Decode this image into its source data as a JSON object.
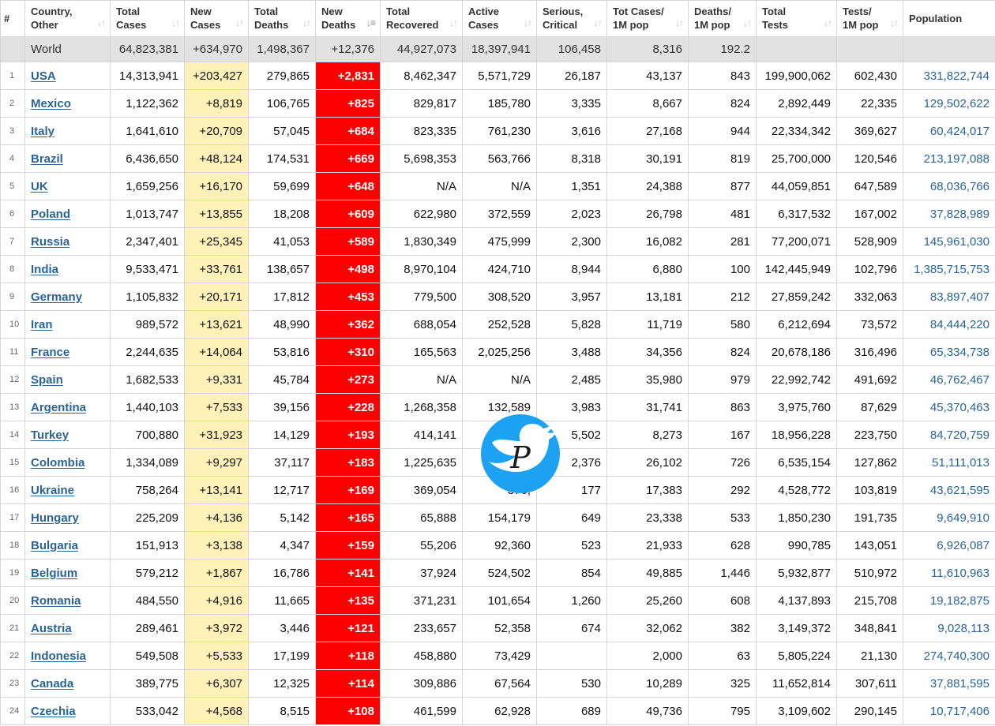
{
  "columns": [
    {
      "key": "num",
      "label": "#"
    },
    {
      "key": "country",
      "label_1": "Country,",
      "label_2": "Other"
    },
    {
      "key": "total_cases",
      "label_1": "Total",
      "label_2": "Cases"
    },
    {
      "key": "new_cases",
      "label_1": "New",
      "label_2": "Cases"
    },
    {
      "key": "total_deaths",
      "label_1": "Total",
      "label_2": "Deaths"
    },
    {
      "key": "new_deaths",
      "label_1": "New",
      "label_2": "Deaths"
    },
    {
      "key": "total_recovered",
      "label_1": "Total",
      "label_2": "Recovered"
    },
    {
      "key": "active_cases",
      "label_1": "Active",
      "label_2": "Cases"
    },
    {
      "key": "serious",
      "label_1": "Serious,",
      "label_2": "Critical"
    },
    {
      "key": "cases_per_1m",
      "label_1": "Tot Cases/",
      "label_2": "1M pop"
    },
    {
      "key": "deaths_per_1m",
      "label_1": "Deaths/",
      "label_2": "1M pop"
    },
    {
      "key": "total_tests",
      "label_1": "Total",
      "label_2": "Tests"
    },
    {
      "key": "tests_per_1m",
      "label_1": "Tests/",
      "label_2": "1M pop"
    },
    {
      "key": "population",
      "label_1": "Population",
      "label_2": ""
    }
  ],
  "sort": {
    "column": "new_deaths",
    "direction": "desc"
  },
  "world": [
    "",
    "World",
    "64,823,381",
    "+634,970",
    "1,498,367",
    "+12,376",
    "44,927,073",
    "18,397,941",
    "106,458",
    "8,316",
    "192.2",
    "",
    "",
    ""
  ],
  "rows": [
    [
      "1",
      "USA",
      "14,313,941",
      "+203,427",
      "279,865",
      "+2,831",
      "8,462,347",
      "5,571,729",
      "26,187",
      "43,137",
      "843",
      "199,900,062",
      "602,430",
      "331,822,744"
    ],
    [
      "2",
      "Mexico",
      "1,122,362",
      "+8,819",
      "106,765",
      "+825",
      "829,817",
      "185,780",
      "3,335",
      "8,667",
      "824",
      "2,892,449",
      "22,335",
      "129,502,622"
    ],
    [
      "3",
      "Italy",
      "1,641,610",
      "+20,709",
      "57,045",
      "+684",
      "823,335",
      "761,230",
      "3,616",
      "27,168",
      "944",
      "22,334,342",
      "369,627",
      "60,424,017"
    ],
    [
      "4",
      "Brazil",
      "6,436,650",
      "+48,124",
      "174,531",
      "+669",
      "5,698,353",
      "563,766",
      "8,318",
      "30,191",
      "819",
      "25,700,000",
      "120,546",
      "213,197,088"
    ],
    [
      "5",
      "UK",
      "1,659,256",
      "+16,170",
      "59,699",
      "+648",
      "N/A",
      "N/A",
      "1,351",
      "24,388",
      "877",
      "44,059,851",
      "647,589",
      "68,036,766"
    ],
    [
      "6",
      "Poland",
      "1,013,747",
      "+13,855",
      "18,208",
      "+609",
      "622,980",
      "372,559",
      "2,023",
      "26,798",
      "481",
      "6,317,532",
      "167,002",
      "37,828,989"
    ],
    [
      "7",
      "Russia",
      "2,347,401",
      "+25,345",
      "41,053",
      "+589",
      "1,830,349",
      "475,999",
      "2,300",
      "16,082",
      "281",
      "77,200,071",
      "528,909",
      "145,961,030"
    ],
    [
      "8",
      "India",
      "9,533,471",
      "+33,761",
      "138,657",
      "+498",
      "8,970,104",
      "424,710",
      "8,944",
      "6,880",
      "100",
      "142,445,949",
      "102,796",
      "1,385,715,753"
    ],
    [
      "9",
      "Germany",
      "1,105,832",
      "+20,171",
      "17,812",
      "+453",
      "779,500",
      "308,520",
      "3,957",
      "13,181",
      "212",
      "27,859,242",
      "332,063",
      "83,897,407"
    ],
    [
      "10",
      "Iran",
      "989,572",
      "+13,621",
      "48,990",
      "+362",
      "688,054",
      "252,528",
      "5,828",
      "11,719",
      "580",
      "6,212,694",
      "73,572",
      "84,444,220"
    ],
    [
      "11",
      "France",
      "2,244,635",
      "+14,064",
      "53,816",
      "+310",
      "165,563",
      "2,025,256",
      "3,488",
      "34,356",
      "824",
      "20,678,186",
      "316,496",
      "65,334,738"
    ],
    [
      "12",
      "Spain",
      "1,682,533",
      "+9,331",
      "45,784",
      "+273",
      "N/A",
      "N/A",
      "2,485",
      "35,980",
      "979",
      "22,992,742",
      "491,692",
      "46,762,467"
    ],
    [
      "13",
      "Argentina",
      "1,440,103",
      "+7,533",
      "39,156",
      "+228",
      "1,268,358",
      "132,589",
      "3,983",
      "31,741",
      "863",
      "3,975,760",
      "87,629",
      "45,370,463"
    ],
    [
      "14",
      "Turkey",
      "700,880",
      "+31,923",
      "14,129",
      "+193",
      "414,141",
      "",
      "5,502",
      "8,273",
      "167",
      "18,956,228",
      "223,750",
      "84,720,759"
    ],
    [
      "15",
      "Colombia",
      "1,334,089",
      "+9,297",
      "37,117",
      "+183",
      "1,225,635",
      "",
      "2,376",
      "26,102",
      "726",
      "6,535,154",
      "127,862",
      "51,111,013"
    ],
    [
      "16",
      "Ukraine",
      "758,264",
      "+13,141",
      "12,717",
      "+169",
      "369,054",
      "376,",
      "177",
      "17,383",
      "292",
      "4,528,772",
      "103,819",
      "43,621,595"
    ],
    [
      "17",
      "Hungary",
      "225,209",
      "+4,136",
      "5,142",
      "+165",
      "65,888",
      "154,179",
      "649",
      "23,338",
      "533",
      "1,850,230",
      "191,735",
      "9,649,910"
    ],
    [
      "18",
      "Bulgaria",
      "151,913",
      "+3,138",
      "4,347",
      "+159",
      "55,206",
      "92,360",
      "523",
      "21,933",
      "628",
      "990,785",
      "143,051",
      "6,926,087"
    ],
    [
      "19",
      "Belgium",
      "579,212",
      "+1,867",
      "16,786",
      "+141",
      "37,924",
      "524,502",
      "854",
      "49,885",
      "1,446",
      "5,932,877",
      "510,972",
      "11,610,963"
    ],
    [
      "20",
      "Romania",
      "484,550",
      "+4,916",
      "11,665",
      "+135",
      "371,231",
      "101,654",
      "1,260",
      "25,260",
      "608",
      "4,137,893",
      "215,708",
      "19,182,875"
    ],
    [
      "21",
      "Austria",
      "289,461",
      "+3,972",
      "3,446",
      "+121",
      "233,657",
      "52,358",
      "674",
      "32,062",
      "382",
      "3,149,372",
      "348,841",
      "9,028,113"
    ],
    [
      "22",
      "Indonesia",
      "549,508",
      "+5,533",
      "17,199",
      "+118",
      "458,880",
      "73,429",
      "",
      "2,000",
      "63",
      "5,805,224",
      "21,130",
      "274,740,300"
    ],
    [
      "23",
      "Canada",
      "389,775",
      "+6,307",
      "12,325",
      "+114",
      "309,886",
      "67,564",
      "530",
      "10,289",
      "325",
      "11,652,814",
      "307,611",
      "37,881,595"
    ],
    [
      "24",
      "Czechia",
      "533,042",
      "+4,568",
      "8,515",
      "+108",
      "461,599",
      "62,928",
      "689",
      "49,736",
      "795",
      "3,109,602",
      "290,145",
      "10,717,406"
    ]
  ],
  "watermark": {
    "icon": "twitter-bird-icon",
    "letter": "P",
    "color": "#1da1f2"
  }
}
